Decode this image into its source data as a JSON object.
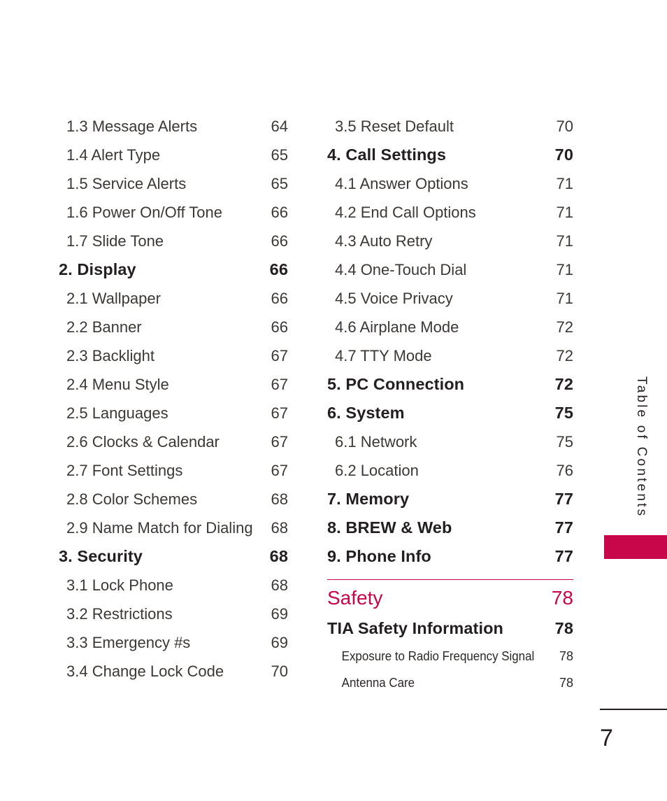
{
  "document": {
    "page_number": "7",
    "side_tab_label": "Table of Contents",
    "accent_color": "#C8074A",
    "text_color": "#231F20"
  },
  "columns": {
    "left": [
      {
        "level": 2,
        "title": "1.3 Message Alerts",
        "page": "64"
      },
      {
        "level": 2,
        "title": "1.4 Alert Type",
        "page": "65"
      },
      {
        "level": 2,
        "title": "1.5 Service Alerts",
        "page": "65"
      },
      {
        "level": 2,
        "title": "1.6 Power On/Off Tone",
        "page": "66"
      },
      {
        "level": 2,
        "title": "1.7 Slide Tone",
        "page": "66"
      },
      {
        "level": 1,
        "title": "2. Display",
        "page": "66"
      },
      {
        "level": 2,
        "title": "2.1 Wallpaper",
        "page": "66"
      },
      {
        "level": 2,
        "title": "2.2 Banner",
        "page": "66"
      },
      {
        "level": 2,
        "title": "2.3 Backlight",
        "page": "67"
      },
      {
        "level": 2,
        "title": "2.4 Menu Style",
        "page": "67"
      },
      {
        "level": 2,
        "title": "2.5 Languages",
        "page": "67"
      },
      {
        "level": 2,
        "title": "2.6 Clocks & Calendar",
        "page": "67"
      },
      {
        "level": 2,
        "title": "2.7 Font Settings",
        "page": "67"
      },
      {
        "level": 2,
        "title": "2.8 Color Schemes",
        "page": "68"
      },
      {
        "level": 2,
        "title": "2.9 Name Match for Dialing",
        "page": "68"
      },
      {
        "level": 1,
        "title": "3. Security",
        "page": "68"
      },
      {
        "level": 2,
        "title": "3.1 Lock Phone",
        "page": "68"
      },
      {
        "level": 2,
        "title": "3.2 Restrictions",
        "page": "69"
      },
      {
        "level": 2,
        "title": "3.3 Emergency #s",
        "page": "69"
      },
      {
        "level": 2,
        "title": "3.4 Change Lock Code",
        "page": "70"
      }
    ],
    "right": [
      {
        "level": 2,
        "title": "3.5 Reset Default",
        "page": "70"
      },
      {
        "level": 1,
        "title": "4. Call Settings",
        "page": "70"
      },
      {
        "level": 2,
        "title": "4.1 Answer Options",
        "page": "71"
      },
      {
        "level": 2,
        "title": "4.2 End Call Options",
        "page": "71"
      },
      {
        "level": 2,
        "title": "4.3 Auto Retry",
        "page": "71"
      },
      {
        "level": 2,
        "title": "4.4 One-Touch Dial",
        "page": "71"
      },
      {
        "level": 2,
        "title": "4.5 Voice Privacy",
        "page": "71"
      },
      {
        "level": 2,
        "title": "4.6 Airplane Mode",
        "page": "72"
      },
      {
        "level": 2,
        "title": "4.7 TTY Mode",
        "page": "72"
      },
      {
        "level": 1,
        "title": "5. PC Connection",
        "page": "72"
      },
      {
        "level": 1,
        "title": "6. System",
        "page": "75"
      },
      {
        "level": 2,
        "title": "6.1 Network",
        "page": "75"
      },
      {
        "level": 2,
        "title": "6.2 Location",
        "page": "76"
      },
      {
        "level": 1,
        "title": "7. Memory",
        "page": "77"
      },
      {
        "level": 1,
        "title": "8. BREW & Web",
        "page": "77"
      },
      {
        "level": 1,
        "title": "9. Phone Info",
        "page": "77"
      },
      {
        "level": 0,
        "title": "Safety",
        "page": "78",
        "rule_above": true
      },
      {
        "level": 1,
        "title": "TIA Safety Information",
        "page": "78"
      },
      {
        "level": 3,
        "title": "Exposure to Radio Frequency Signal",
        "page": "78"
      },
      {
        "level": 3,
        "title": "Antenna Care",
        "page": "78"
      }
    ]
  }
}
